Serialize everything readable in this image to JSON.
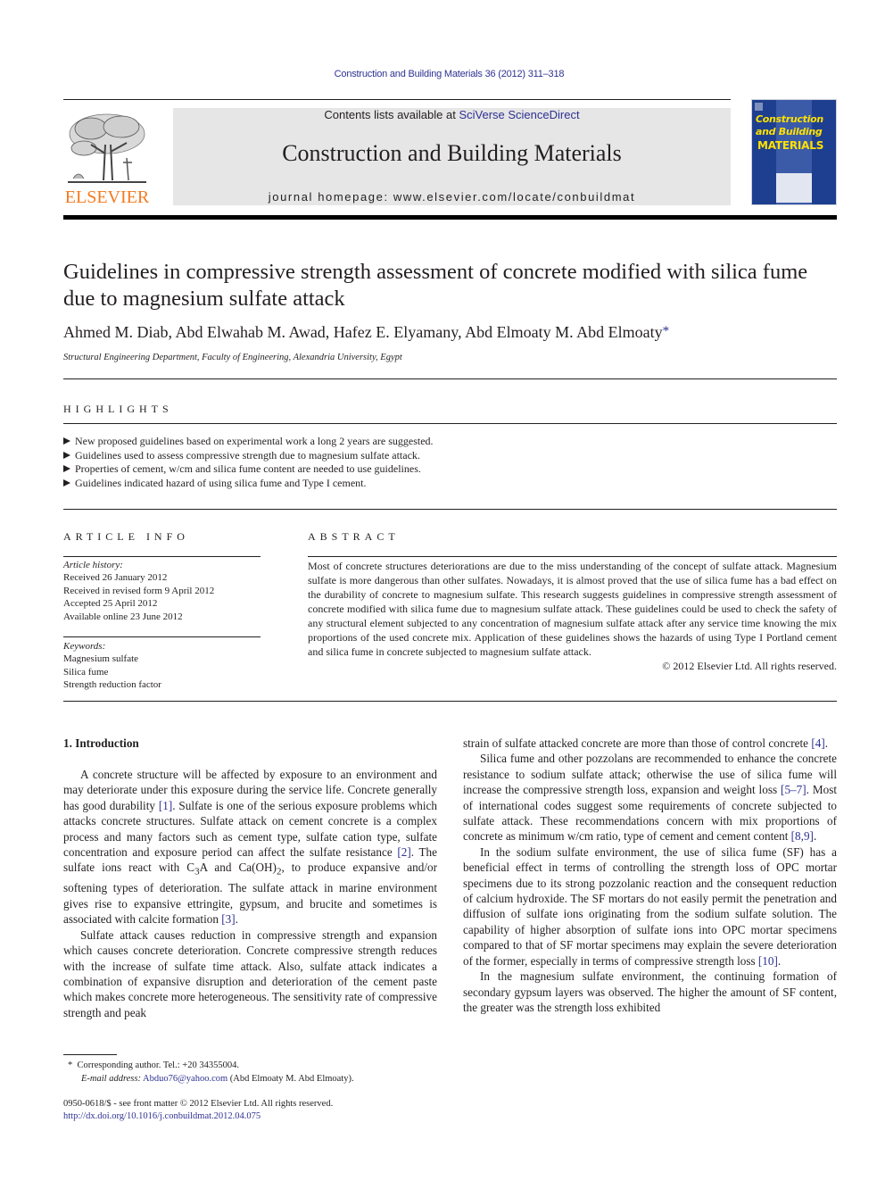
{
  "journal_header": {
    "running_head": "Construction and Building Materials 36 (2012) 311–318",
    "publisher_logo_text": "ELSEVIER",
    "contents_prefix": "Contents lists available at ",
    "contents_link": "SciVerse ScienceDirect",
    "journal_title": "Construction and Building Materials",
    "homepage_label": "journal homepage: www.elsevier.com/locate/conbuildmat",
    "cover": {
      "line1": "Construction",
      "line2": "and Building",
      "line3": "MATERIALS"
    }
  },
  "colors": {
    "link": "#2e3192",
    "elsevier_orange": "#f47b20",
    "cover_blue": "#1e3f8f",
    "cover_yellow": "#ffe100",
    "banner_gray": "#e6e6e6"
  },
  "article": {
    "title": "Guidelines in compressive strength assessment of concrete modified with silica fume due to magnesium sulfate attack",
    "authors": "Ahmed M. Diab, Abd Elwahab M. Awad, Hafez E. Elyamany, Abd Elmoaty M. Abd Elmoaty",
    "author_marker": "*",
    "affiliation": "Structural Engineering Department, Faculty of Engineering, Alexandria University, Egypt"
  },
  "highlights": {
    "heading": "HIGHLIGHTS",
    "items": [
      "New proposed guidelines based on experimental work a long 2 years are suggested.",
      "Guidelines used to assess compressive strength due to magnesium sulfate attack.",
      "Properties of cement, w/cm and silica fume content are needed to use guidelines.",
      "Guidelines indicated hazard of using silica fume and Type I cement."
    ]
  },
  "article_info": {
    "heading": "ARTICLE INFO",
    "history_label": "Article history:",
    "history": [
      "Received 26 January 2012",
      "Received in revised form 9 April 2012",
      "Accepted 25 April 2012",
      "Available online 23 June 2012"
    ],
    "keywords_label": "Keywords:",
    "keywords": [
      "Magnesium sulfate",
      "Silica fume",
      "Strength reduction factor"
    ]
  },
  "abstract": {
    "heading": "ABSTRACT",
    "text": "Most of concrete structures deteriorations are due to the miss understanding of the concept of sulfate attack. Magnesium sulfate is more dangerous than other sulfates. Nowadays, it is almost proved that the use of silica fume has a bad effect on the durability of concrete to magnesium sulfate. This research suggests guidelines in compressive strength assessment of concrete modified with silica fume due to magnesium sulfate attack. These guidelines could be used to check the safety of any structural element subjected to any concentration of magnesium sulfate attack after any service time knowing the mix proportions of the used concrete mix. Application of these guidelines shows the hazards of using Type I Portland cement and silica fume in concrete subjected to magnesium sulfate attack.",
    "copyright": "© 2012 Elsevier Ltd. All rights reserved."
  },
  "introduction": {
    "heading": "1. Introduction",
    "left": {
      "p1_a": "A concrete structure will be affected by exposure to an environment and may deteriorate under this exposure during the service life. Concrete generally has good durability ",
      "p1_ref1": "[1]",
      "p1_b": ". Sulfate is one of the serious exposure problems which attacks concrete structures. Sulfate attack on cement concrete is a complex process and many factors such as cement type, sulfate cation type, sulfate concentration and exposure period can affect the sulfate resistance ",
      "p1_ref2": "[2]",
      "p1_c": ". The sulfate ions react with C",
      "p1_sub3": "3",
      "p1_d": "A and Ca(OH)",
      "p1_sub2": "2",
      "p1_e": ", to produce expansive and/or softening types of deterioration. The sulfate attack in marine environment gives rise to expansive ettringite, gypsum, and brucite and sometimes is associated with calcite formation ",
      "p1_ref3": "[3]",
      "p1_f": ".",
      "p2": "Sulfate attack causes reduction in compressive strength and expansion which causes concrete deterioration. Concrete compressive strength reduces with the increase of sulfate time attack. Also, sulfate attack indicates a combination of expansive disruption and deterioration of the cement paste which makes concrete more heterogeneous. The sensitivity rate of compressive strength and peak"
    },
    "right": {
      "p0_a": "strain of sulfate attacked concrete are more than those of control concrete ",
      "p0_ref": "[4]",
      "p0_b": ".",
      "p1_a": "Silica fume and other pozzolans are recommended to enhance the concrete resistance to sodium sulfate attack; otherwise the use of silica fume will increase the compressive strength loss, expansion and weight loss ",
      "p1_ref1": "[5–7]",
      "p1_b": ". Most of international codes suggest some requirements of concrete subjected to sulfate attack. These recommendations concern with mix proportions of concrete as minimum w/cm ratio, type of cement and cement content ",
      "p1_ref2": "[8,9]",
      "p1_c": ".",
      "p2_a": "In the sodium sulfate environment, the use of silica fume (SF) has a beneficial effect in terms of controlling the strength loss of OPC mortar specimens due to its strong pozzolanic reaction and the consequent reduction of calcium hydroxide. The SF mortars do not easily permit the penetration and diffusion of sulfate ions originating from the sodium sulfate solution. The capability of higher absorption of sulfate ions into OPC mortar specimens compared to that of SF mortar specimens may explain the severe deterioration of the former, especially in terms of compressive strength loss ",
      "p2_ref": "[10]",
      "p2_b": ".",
      "p3": "In the magnesium sulfate environment, the continuing formation of secondary gypsum layers was observed. The higher the amount of SF content, the greater was the strength loss exhibited"
    }
  },
  "footnote": {
    "marker": "*",
    "corresponding": "Corresponding author. Tel.: +20 34355004.",
    "email_label": "E-mail address:",
    "email": "Abduo76@yahoo.com",
    "email_owner": "(Abd Elmoaty M. Abd Elmoaty)."
  },
  "front_matter": {
    "issn_line": "0950-0618/$ - see front matter © 2012 Elsevier Ltd. All rights reserved.",
    "doi": "http://dx.doi.org/10.1016/j.conbuildmat.2012.04.075"
  }
}
